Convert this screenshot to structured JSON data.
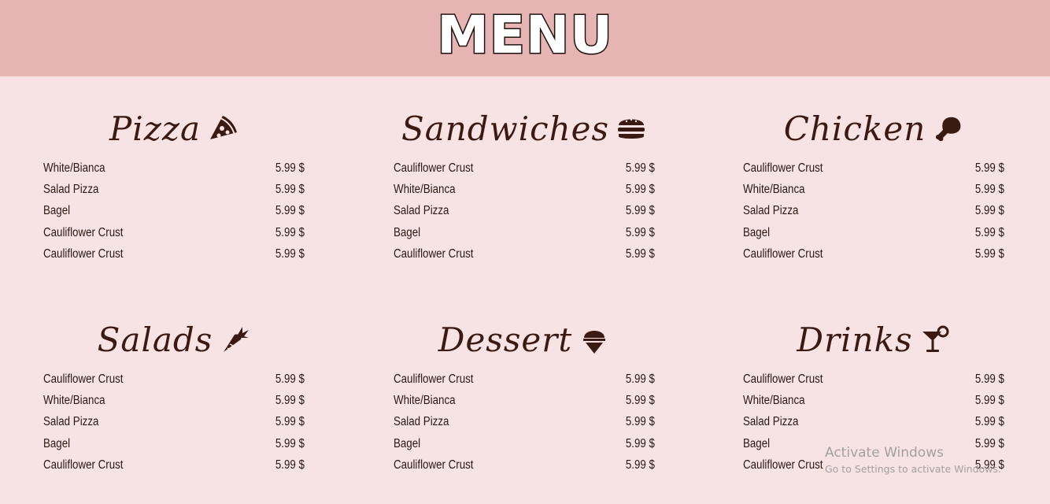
{
  "header": {
    "title": "MENU"
  },
  "sections": [
    {
      "title": "Pizza",
      "icon": "pizza-slice-icon",
      "items": [
        {
          "name": "White/Bianca",
          "price": "5.99 $"
        },
        {
          "name": "Salad Pizza",
          "price": "5.99 $"
        },
        {
          "name": "Bagel",
          "price": "5.99 $"
        },
        {
          "name": "Cauliflower Crust",
          "price": "5.99 $"
        },
        {
          "name": "Cauliflower Crust",
          "price": "5.99 $"
        }
      ]
    },
    {
      "title": "Sandwiches",
      "icon": "hamburger-icon",
      "items": [
        {
          "name": "Cauliflower Crust",
          "price": "5.99 $"
        },
        {
          "name": "White/Bianca",
          "price": "5.99 $"
        },
        {
          "name": "Salad Pizza",
          "price": "5.99 $"
        },
        {
          "name": "Bagel",
          "price": "5.99 $"
        },
        {
          "name": "Cauliflower Crust",
          "price": "5.99 $"
        }
      ]
    },
    {
      "title": "Chicken",
      "icon": "drumstick-icon",
      "items": [
        {
          "name": "Cauliflower Crust",
          "price": "5.99 $"
        },
        {
          "name": "White/Bianca",
          "price": "5.99 $"
        },
        {
          "name": "Salad Pizza",
          "price": "5.99 $"
        },
        {
          "name": "Bagel",
          "price": "5.99 $"
        },
        {
          "name": "Cauliflower Crust",
          "price": "5.99 $"
        }
      ]
    },
    {
      "title": "Salads",
      "icon": "carrot-icon",
      "items": [
        {
          "name": "Cauliflower Crust",
          "price": "5.99 $"
        },
        {
          "name": "White/Bianca",
          "price": "5.99 $"
        },
        {
          "name": "Salad Pizza",
          "price": "5.99 $"
        },
        {
          "name": "Bagel",
          "price": "5.99 $"
        },
        {
          "name": "Cauliflower Crust",
          "price": "5.99 $"
        }
      ]
    },
    {
      "title": "Dessert",
      "icon": "ice-cream-icon",
      "items": [
        {
          "name": "Cauliflower Crust",
          "price": "5.99 $"
        },
        {
          "name": "White/Bianca",
          "price": "5.99 $"
        },
        {
          "name": "Salad Pizza",
          "price": "5.99 $"
        },
        {
          "name": "Bagel",
          "price": "5.99 $"
        },
        {
          "name": "Cauliflower Crust",
          "price": "5.99 $"
        }
      ]
    },
    {
      "title": "Drinks",
      "icon": "cocktail-icon",
      "items": [
        {
          "name": "Cauliflower Crust",
          "price": "5.99 $"
        },
        {
          "name": "White/Bianca",
          "price": "5.99 $"
        },
        {
          "name": "Salad Pizza",
          "price": "5.99 $"
        },
        {
          "name": "Bagel",
          "price": "5.99 $"
        },
        {
          "name": "Cauliflower Crust",
          "price": "5.99 $"
        }
      ]
    }
  ],
  "watermark": {
    "title": "Activate Windows",
    "subtitle": "Go to Settings to activate Windows."
  },
  "colors": {
    "header_bg": "#e6b5b3",
    "page_bg": "#f7e3e3",
    "text": "#2a1712",
    "title": "#3a1a12"
  }
}
